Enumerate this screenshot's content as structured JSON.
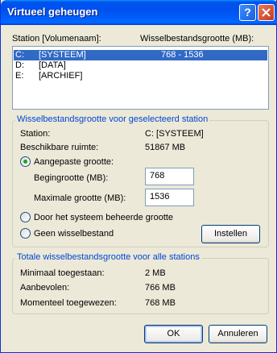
{
  "window": {
    "title": "Virtueel geheugen"
  },
  "titlebar": {
    "help_glyph": "?",
    "close_icon": "close-icon"
  },
  "drive_list": {
    "header_station": "Station  [Volumenaam]:",
    "header_size": "Wisselbestandsgrootte (MB):",
    "rows": [
      {
        "drive": "C:",
        "label": "[SYSTEEM]",
        "size": "768 - 1536",
        "selected": true
      },
      {
        "drive": "D:",
        "label": "[DATA]",
        "size": "",
        "selected": false
      },
      {
        "drive": "E:",
        "label": "[ARCHIEF]",
        "size": "",
        "selected": false
      }
    ]
  },
  "selected_group": {
    "title": "Wisselbestandsgrootte voor geselecteerd station",
    "station_label": "Station:",
    "station_value": "C:  [SYSTEEM]",
    "space_label": "Beschikbare ruimte:",
    "space_value": "51867 MB",
    "custom_size_label": "Aangepaste grootte:",
    "initial_label": "Begingrootte (MB):",
    "initial_value": "768",
    "max_label": "Maximale grootte (MB):",
    "max_value": "1536",
    "system_managed_label": "Door het systeem beheerde grootte",
    "no_pagefile_label": "Geen wisselbestand",
    "set_button": "Instellen",
    "selected_option": "custom"
  },
  "totals_group": {
    "title": "Totale wisselbestandsgrootte voor alle stations",
    "min_label": "Minimaal toegestaan:",
    "min_value": "2 MB",
    "recommended_label": "Aanbevolen:",
    "recommended_value": "766 MB",
    "current_label": "Momenteel toegewezen:",
    "current_value": "768 MB"
  },
  "buttons": {
    "ok": "OK",
    "cancel": "Annuleren"
  },
  "colors": {
    "title_bar": "#0053ee",
    "selection": "#316ac5",
    "group_title": "#0046d5",
    "dialog_bg": "#ece9d8"
  }
}
